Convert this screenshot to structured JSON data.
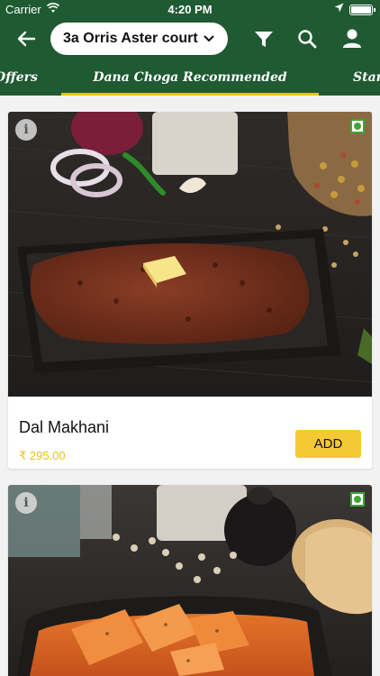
{
  "status_bar": {
    "carrier": "Carrier",
    "time": "4:20 PM"
  },
  "header": {
    "location": "3a Orris Aster court"
  },
  "tabs": [
    {
      "label": "Offers"
    },
    {
      "label": "Dana Choga Recommended",
      "active": true
    },
    {
      "label": "Starters"
    }
  ],
  "menu_items": [
    {
      "name": "Dal Makhani",
      "price": "₹ 295.00",
      "add_label": "ADD",
      "info_label": "i",
      "veg": true
    },
    {
      "name": "",
      "price": "",
      "add_label": "",
      "info_label": "i",
      "veg": true
    }
  ],
  "colors": {
    "primary": "#1f5a32",
    "accent": "#e8c21a",
    "button": "#f5c933",
    "veg": "#3fa535"
  },
  "icons": [
    "back-arrow-icon",
    "chevron-down-icon",
    "filter-icon",
    "search-icon",
    "profile-icon",
    "wifi-icon",
    "location-arrow-icon",
    "battery-icon",
    "info-icon",
    "veg-indicator-icon"
  ]
}
